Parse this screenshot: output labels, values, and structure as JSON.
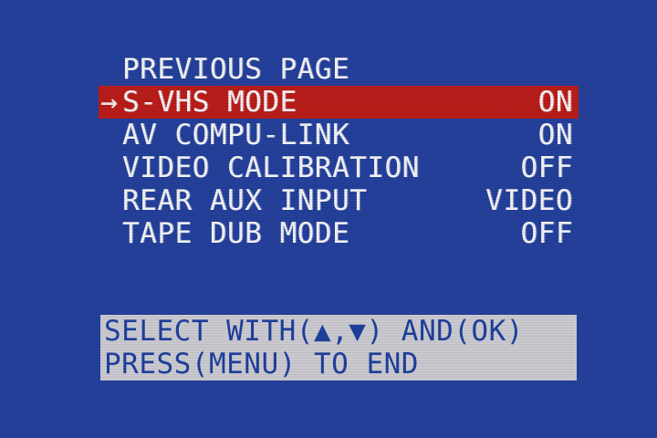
{
  "menu": {
    "items": [
      {
        "label": "PREVIOUS PAGE",
        "value": "",
        "selected": false
      },
      {
        "label": "S-VHS MODE",
        "value": "ON",
        "selected": true
      },
      {
        "label": "AV COMPU-LINK",
        "value": "ON",
        "selected": false
      },
      {
        "label": "VIDEO CALIBRATION",
        "value": "OFF",
        "selected": false
      },
      {
        "label": "REAR AUX INPUT",
        "value": "VIDEO",
        "selected": false
      },
      {
        "label": "TAPE DUB MODE",
        "value": "OFF",
        "selected": false
      }
    ],
    "cursor_icon": "arrow-right",
    "cursor_glyph": "→"
  },
  "help": {
    "line1": "SELECT WITH(▲,▼) AND(OK)",
    "line2": "PRESS(MENU) TO END"
  },
  "colors": {
    "background": "#24409a",
    "highlight": "#b81d1a",
    "text": "#f2f2f4",
    "help_background": "#c9c9cf",
    "help_text": "#1e3f9c"
  }
}
